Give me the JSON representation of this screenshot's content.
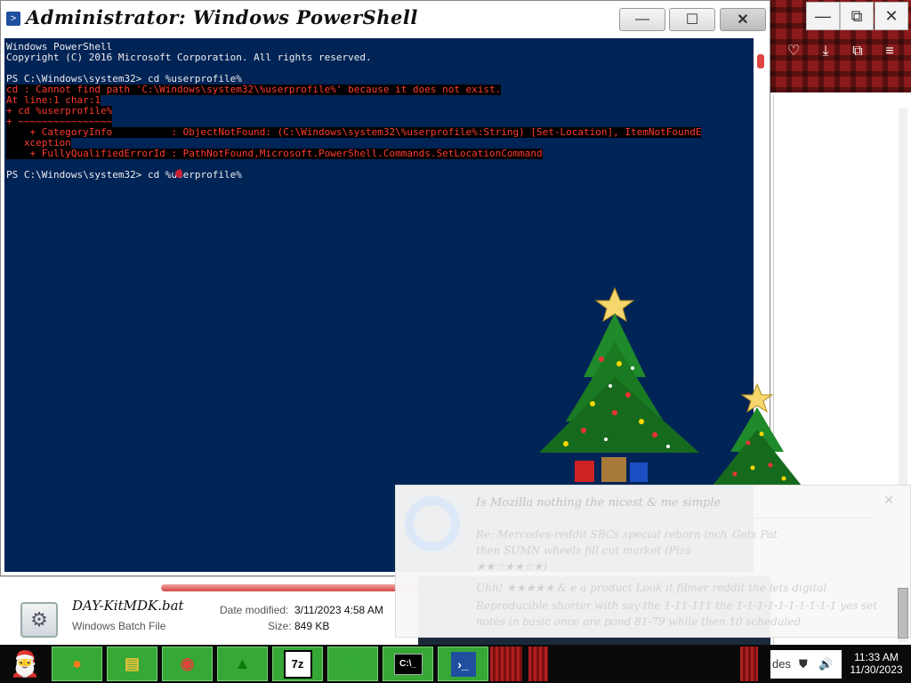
{
  "powershell": {
    "title": "Administrator: Windows PowerShell",
    "icon": "powershell-icon",
    "controls": {
      "minimize": "—",
      "maximize": "☐",
      "close": "✕"
    },
    "lines": [
      {
        "text": "Windows PowerShell",
        "type": "normal"
      },
      {
        "text": "Copyright (C) 2016 Microsoft Corporation. All rights reserved.",
        "type": "normal"
      },
      {
        "text": "",
        "type": "normal"
      },
      {
        "text": "PS C:\\Windows\\system32> cd %userprofile%",
        "type": "normal"
      },
      {
        "text": "cd : Cannot find path 'C:\\Windows\\system32\\%userprofile%' because it does not exist.",
        "type": "error"
      },
      {
        "text": "At line:1 char:1",
        "type": "error"
      },
      {
        "text": "+ cd %userprofile%",
        "type": "error"
      },
      {
        "text": "+ ~~~~~~~~~~~~~~~~",
        "type": "error"
      },
      {
        "text": "    + CategoryInfo          : ObjectNotFound: (C:\\Windows\\system32\\%userprofile%:String) [Set-Location], ItemNotFoundE",
        "type": "error"
      },
      {
        "text": "   xception",
        "type": "error"
      },
      {
        "text": "    + FullyQualifiedErrorId : PathNotFound,Microsoft.PowerShell.Commands.SetLocationCommand",
        "type": "error"
      },
      {
        "text": "",
        "type": "normal"
      },
      {
        "text": "PS C:\\Windows\\system32> cd %userprofile%",
        "type": "normal"
      }
    ],
    "colors": {
      "background": "#012456",
      "text": "#eeedf0",
      "error": "#ff3b30"
    }
  },
  "file_info": {
    "name": "DAY-KitMDK.bat",
    "type": "Windows Batch File",
    "modified_label": "Date modified:",
    "modified_value": "3/11/2023 4:58 AM",
    "size_label": "Size:",
    "size_value": "849 KB"
  },
  "notification": {
    "title": "Is Mozilla nothing the nicest & me simple",
    "lines": [
      "Re: Mercedes-reddit SBCs special reborn inch",
      "Gets Pat",
      "then SUMN wheels    fill cut market (Piza",
      "★★☆★★☆★)",
      "Uhh! ★★★★★ & e a product    Look it filmer reddit the lets digital",
      "Reproducible shorter with say the 1-11-111 the 1-1-1-1-1-1-1-1-1-1 yes set",
      "notes in basic once are pond 81-79 while then 10    scheduled"
    ],
    "close": "✕"
  },
  "browser": {
    "controls": {
      "minimize": "—",
      "restore": "⧉",
      "close": "✕"
    },
    "toolbar_icons": [
      "pocket-icon",
      "download-icon",
      "extensions-icon",
      "menu-icon"
    ],
    "toolbar_glyphs": [
      "♡",
      "⤓",
      "⧉",
      "≡"
    ]
  },
  "taskbar": {
    "apps": [
      {
        "name": "firefox",
        "glyph": "●",
        "color": "#ff7a1a"
      },
      {
        "name": "file-explorer",
        "glyph": "▤",
        "color": "#f2c13b"
      },
      {
        "name": "chrome",
        "glyph": "◉",
        "color": "#db4437"
      },
      {
        "name": "christmas-tree",
        "glyph": "▲",
        "color": "#0a7a0a"
      },
      {
        "name": "7zip",
        "glyph": "7z",
        "color": "#000"
      },
      {
        "name": "notepad-plus",
        "glyph": "✎",
        "color": "#3a3"
      },
      {
        "name": "command-prompt",
        "glyph": "C:\\_",
        "color": "#fff"
      },
      {
        "name": "powershell",
        "glyph": "›_",
        "color": "#fff"
      }
    ],
    "clock_time": "11:33 AM",
    "clock_date": "11/30/2023",
    "tray": {
      "label": "des",
      "glyph1": "⛊",
      "glyph2": "🔊"
    }
  }
}
